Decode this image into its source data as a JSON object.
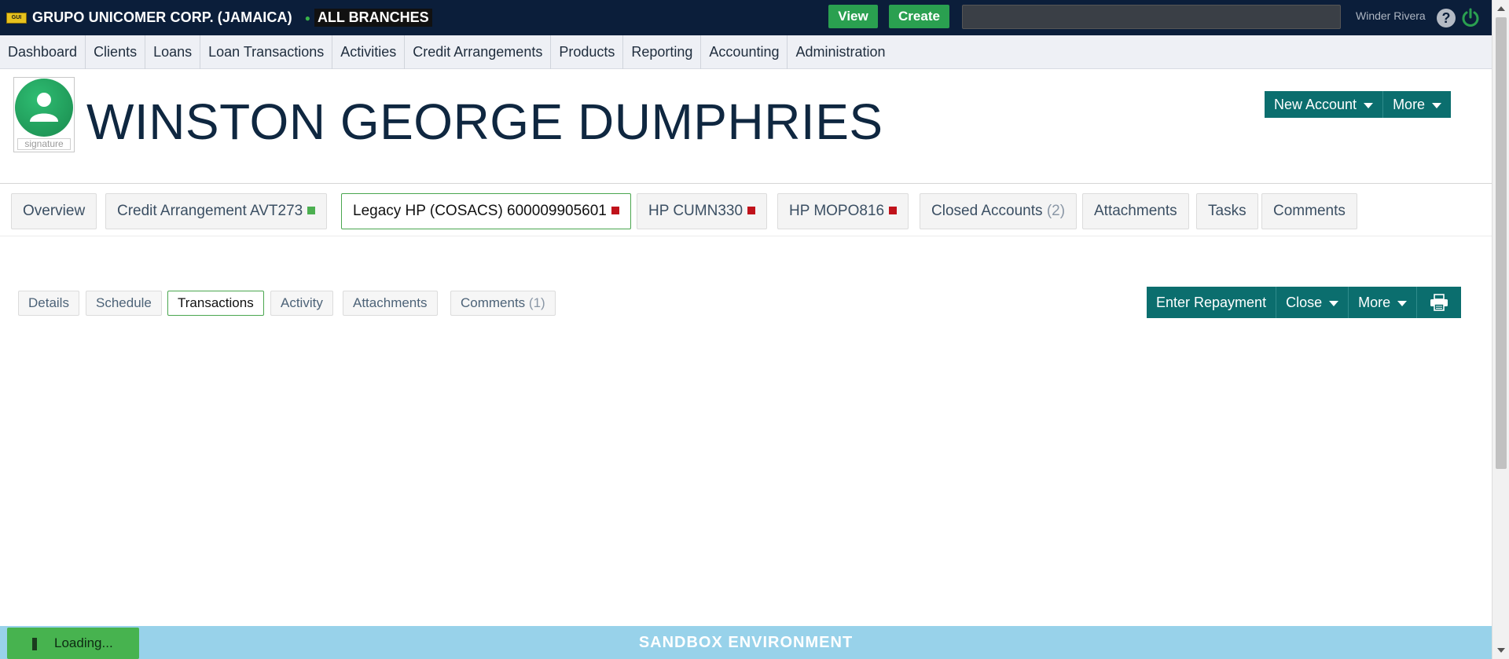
{
  "topbar": {
    "logo_text": "GUI",
    "company": "GRUPO UNICOMER CORP. (JAMAICA)",
    "branch": "ALL BRANCHES",
    "view_label": "View",
    "create_label": "Create",
    "search_value": "",
    "user_name": "Winder Rivera",
    "help_glyph": "?"
  },
  "nav": [
    "Dashboard",
    "Clients",
    "Loans",
    "Loan Transactions",
    "Activities",
    "Credit Arrangements",
    "Products",
    "Reporting",
    "Accounting",
    "Administration"
  ],
  "client": {
    "name": "WINSTON GEORGE DUMPHRIES",
    "signature_label": "signature",
    "new_account_label": "New Account",
    "more_label": "More"
  },
  "tabs": [
    {
      "label": "Overview",
      "status": ""
    },
    {
      "label": "Credit Arrangement AVT273",
      "status": "green"
    },
    {
      "label": "Legacy HP (COSACS) 600009905601",
      "status": "red"
    },
    {
      "label": "HP CUMN330",
      "status": "red"
    },
    {
      "label": "HP MOPO816",
      "status": "red"
    },
    {
      "label": "Closed Accounts",
      "count": "(2)",
      "status": ""
    },
    {
      "label": "Attachments",
      "status": ""
    },
    {
      "label": "Tasks",
      "status": ""
    },
    {
      "label": "Comments",
      "status": ""
    }
  ],
  "subtabs": [
    "Details",
    "Schedule",
    "Transactions",
    "Activity",
    "Attachments",
    "Comments"
  ],
  "subtab_comments_count": "(1)",
  "actions": {
    "enter_repayment": "Enter Repayment",
    "close": "Close",
    "more": "More"
  },
  "footer": {
    "environment": "SANDBOX ENVIRONMENT",
    "loading": "Loading..."
  },
  "colors": {
    "topbar": "#0b1e3a",
    "teal": "#0b6e6e",
    "status_green": "#4caf50",
    "status_red": "#c0121b",
    "active_tab_border": "#4aa64f",
    "footer": "#98d2ea"
  },
  "icons": [
    "help-icon",
    "power-icon",
    "user-avatar-icon",
    "print-icon",
    "chevron-down-icon"
  ]
}
